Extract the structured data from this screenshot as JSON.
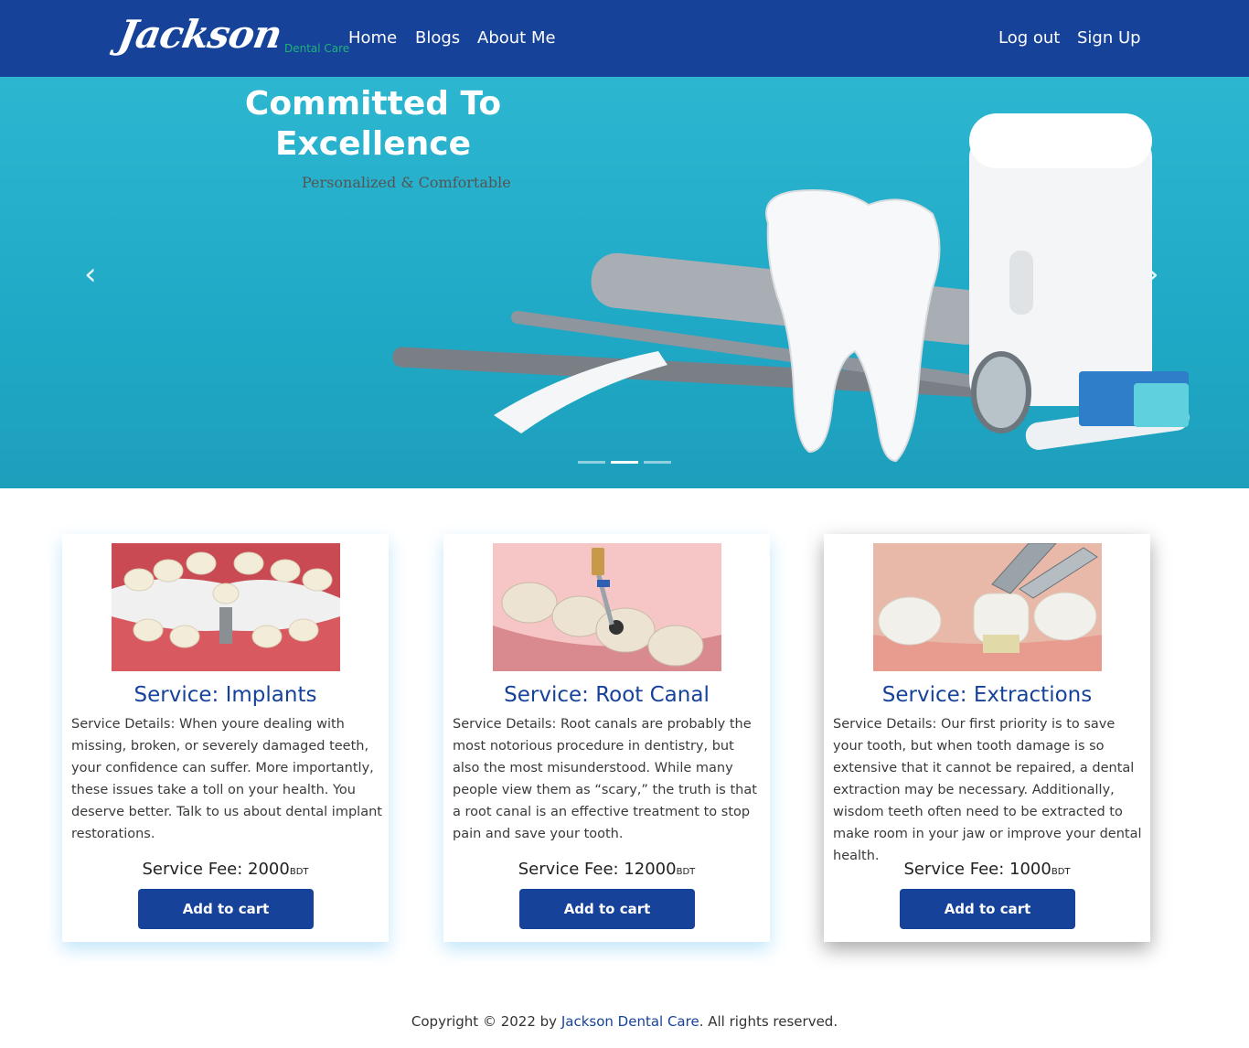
{
  "colors": {
    "primary": "#16429a",
    "brand_accent": "#1fb37a",
    "hero_bg": "#1fa9c6"
  },
  "nav": {
    "brand_script": "Jackson",
    "brand_sub": "Dental Care",
    "links": [
      "Home",
      "Blogs",
      "About Me"
    ],
    "logout": "Log out",
    "signup": "Sign Up"
  },
  "hero": {
    "title": "Committed To Excellence",
    "subtitle": "Personalized & Comfortable",
    "prev_icon": "chevron-left-icon",
    "next_icon": "chevron-right-icon",
    "slides": 3,
    "active_slide": 2
  },
  "services": [
    {
      "title": "Service: Implants",
      "details": "Service Details: When youre dealing with missing, broken, or severely damaged teeth, your confidence can suffer. More importantly, these issues take a toll on your health. You deserve better. Talk to us about dental implant restorations.",
      "fee_label": "Service Fee: ",
      "fee": "2000",
      "unit": "BDT",
      "button": "Add to cart"
    },
    {
      "title": "Service: Root Canal",
      "details": "Service Details: Root canals are probably the most notorious procedure in dentistry, but also the most misunderstood. While many people view them as “scary,” the truth is that a root canal is an effective treatment to stop pain and save your tooth.",
      "fee_label": "Service Fee: ",
      "fee": "12000",
      "unit": "BDT",
      "button": "Add to cart"
    },
    {
      "title": "Service: Extractions",
      "details": "Service Details: Our first priority is to save your tooth, but when tooth damage is so extensive that it cannot be repaired, a dental extraction may be necessary. Additionally, wisdom teeth often need to be extracted to make room in your jaw or improve your dental health.",
      "fee_label": "Service Fee: ",
      "fee": "1000",
      "unit": "BDT",
      "button": "Add to cart"
    }
  ],
  "footer": {
    "prefix": "Copyright © 2022 by ",
    "brand": "Jackson Dental Care",
    "suffix": ". All rights reserved."
  }
}
